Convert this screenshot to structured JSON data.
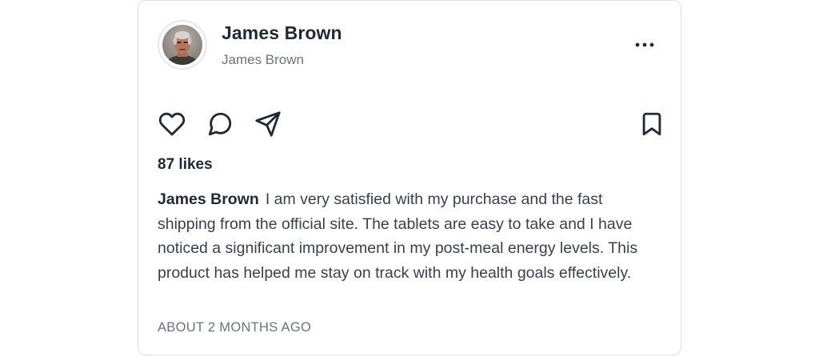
{
  "post": {
    "author": {
      "name": "James Brown",
      "handle": "James Brown",
      "avatar_icon": "user-photo-avatar"
    },
    "menu_icon": "more-horizontal-icon",
    "actions": {
      "like_icon": "heart-icon",
      "comment_icon": "comment-icon",
      "share_icon": "send-icon",
      "save_icon": "bookmark-icon"
    },
    "likes": "87 likes",
    "caption": {
      "author": "James Brown",
      "text": "I am very satisfied with my purchase and the fast shipping from the official site. The tablets are easy to take and I have noticed a significant improvement in my post-meal energy levels. This product has helped me stay on track with my health goals effectively."
    },
    "timestamp": "ABOUT 2 MONTHS AGO"
  },
  "colors": {
    "text_primary": "#1f2937",
    "text_secondary": "#6b7280",
    "border": "#dde1e6"
  }
}
